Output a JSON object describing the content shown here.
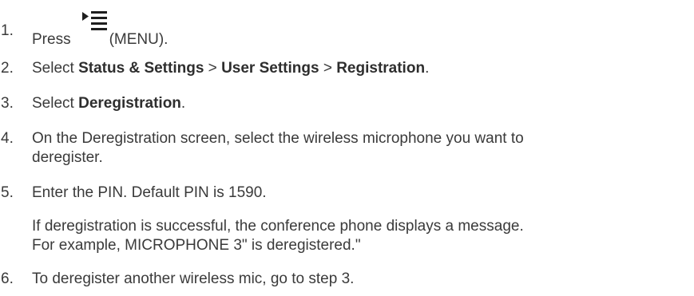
{
  "steps": [
    {
      "number": "1.",
      "press": "Press",
      "icon": "menu-icon",
      "menu_label": "(MENU)."
    },
    {
      "number": "2.",
      "select": "Select",
      "item1": "Status & Settings",
      "sep1": " > ",
      "item2": "User Settings",
      "sep2": " > ",
      "item3": "Registration",
      "end": "."
    },
    {
      "number": "3.",
      "select": "Select",
      "item": "Deregistration",
      "end": "."
    },
    {
      "number": "4.",
      "line1": "On the Deregistration screen, select the wireless microphone you want to",
      "line2": "deregister."
    },
    {
      "number": "5.",
      "text": "Enter the PIN. Default PIN is 1590.",
      "note_line1": "If deregistration is successful, the conference phone displays a message.",
      "note_line2": "For example, MICROPHONE 3\" is deregistered.\""
    },
    {
      "number": "6.",
      "text": "To deregister another wireless mic, go to step 3."
    }
  ]
}
